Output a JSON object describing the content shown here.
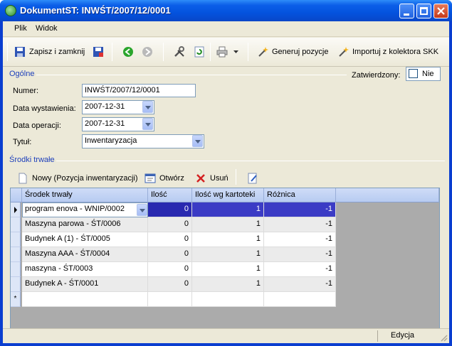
{
  "window": {
    "title": "DokumentST: INWŚT/2007/12/0001"
  },
  "menu": {
    "items": [
      "Plik",
      "Widok"
    ]
  },
  "toolbar": {
    "save_close": "Zapisz i zamknij",
    "generate": "Generuj pozycje",
    "import": "Importuj z kolektora SKK"
  },
  "general": {
    "section_title": "Ogólne",
    "confirmed_label": "Zatwierdzony:",
    "confirmed_value": "Nie",
    "number_label": "Numer:",
    "number_value": "INWŚT/2007/12/0001",
    "issue_date_label": "Data wystawienia:",
    "issue_date_value": "2007-12-31",
    "operation_date_label": "Data operacji:",
    "operation_date_value": "2007-12-31",
    "title_label": "Tytuł:",
    "title_value": "Inwentaryzacja"
  },
  "assets": {
    "section_title": "Środki trwałe",
    "new_label": "Nowy (Pozycja inwentaryzacji)",
    "open_label": "Otwórz",
    "delete_label": "Usuń",
    "columns": [
      "Środek trwały",
      "Ilość",
      "Ilość wg kartoteki",
      "Różnica"
    ],
    "rows": [
      [
        "program enova - WNIP/0002",
        "0",
        "1",
        "-1"
      ],
      [
        "Maszyna parowa - ŚT/0006",
        "0",
        "1",
        "-1"
      ],
      [
        "Budynek A  (1) - ŚT/0005",
        "0",
        "1",
        "-1"
      ],
      [
        "Maszyna AAA - ŚT/0004",
        "0",
        "1",
        "-1"
      ],
      [
        "maszyna - ŚT/0003",
        "0",
        "1",
        "-1"
      ],
      [
        "Budynek A - ŚT/0001",
        "0",
        "1",
        "-1"
      ]
    ],
    "new_row_marker": "*"
  },
  "status": {
    "mode": "Edycja"
  },
  "colors": {
    "titlebar": "#0453de",
    "section_title": "#1d3fbb",
    "selection": "#2929b0"
  }
}
